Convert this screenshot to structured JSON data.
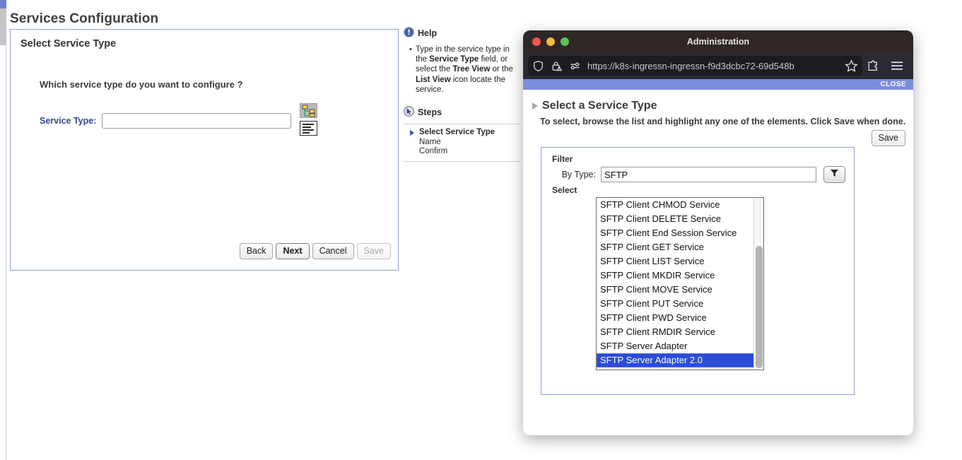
{
  "app": {
    "page_title": "Services Configuration",
    "panel_title": "Select Service Type",
    "question": "Which service type do you want to configure ?",
    "service_type_label": "Service Type:",
    "service_type_value": "",
    "service_type_placeholder": "",
    "tree_view_icon": "tree-view-icon",
    "list_view_icon": "list-view-icon",
    "buttons": [
      {
        "label": "Back",
        "state": "enabled"
      },
      {
        "label": "Next",
        "state": "enabled-default"
      },
      {
        "label": "Cancel",
        "state": "enabled"
      },
      {
        "label": "Save",
        "state": "disabled"
      }
    ]
  },
  "help": {
    "title": "Help",
    "icon": "exclamation-circle-icon",
    "body_parts": [
      {
        "text": "Type in the service type in the ",
        "bold": false
      },
      {
        "text": "Service Type",
        "bold": true
      },
      {
        "text": " field, or select the ",
        "bold": false
      },
      {
        "text": "Tree View",
        "bold": true
      },
      {
        "text": " or the ",
        "bold": false
      },
      {
        "text": "List View",
        "bold": true
      },
      {
        "text": " icon locate the service.",
        "bold": false
      }
    ],
    "steps_title": "Steps",
    "steps_icon": "cursor-circle-icon",
    "steps": [
      {
        "label": "Select Service Type",
        "current": true
      },
      {
        "label": "Name",
        "current": false
      },
      {
        "label": "Confirm",
        "current": false
      }
    ]
  },
  "browser": {
    "window_title": "Administration",
    "traffic_lights": [
      "close-red",
      "minimize-yellow",
      "zoom-green"
    ],
    "url": "https://k8s-ingressn-ingressn-f9d3dcbc72-69d548b",
    "left_icons": [
      "shield-icon",
      "lock-warning-icon",
      "tracking-settings-icon"
    ],
    "right_icons": [
      "bookmark-star-icon",
      "extensions-puzzle-icon",
      "hamburger-menu-icon"
    ],
    "close_bar_label": "CLOSE",
    "accent_blue": "#7b8ede"
  },
  "dialog": {
    "title": "Select a Service Type",
    "subtitle": "To select, browse the list and highlight any one of the elements. Click Save when done.",
    "save_label": "Save",
    "filter_label": "Filter",
    "by_type_label": "By Type:",
    "by_type_value": "SFTP",
    "filter_button_icon": "funnel-filter-icon",
    "select_label": "Select",
    "selection_color": "#2b4cd8",
    "list_items": [
      {
        "label": "SFTP Client CHMOD Service",
        "selected": false
      },
      {
        "label": "SFTP Client DELETE Service",
        "selected": false
      },
      {
        "label": "SFTP Client End Session Service",
        "selected": false
      },
      {
        "label": "SFTP Client GET Service",
        "selected": false
      },
      {
        "label": "SFTP Client LIST Service",
        "selected": false
      },
      {
        "label": "SFTP Client MKDIR Service",
        "selected": false
      },
      {
        "label": "SFTP Client MOVE Service",
        "selected": false
      },
      {
        "label": "SFTP Client PUT Service",
        "selected": false
      },
      {
        "label": "SFTP Client PWD Service",
        "selected": false
      },
      {
        "label": "SFTP Client RMDIR Service",
        "selected": false
      },
      {
        "label": "SFTP Server Adapter",
        "selected": false
      },
      {
        "label": "SFTP Server Adapter 2.0",
        "selected": true
      }
    ]
  }
}
